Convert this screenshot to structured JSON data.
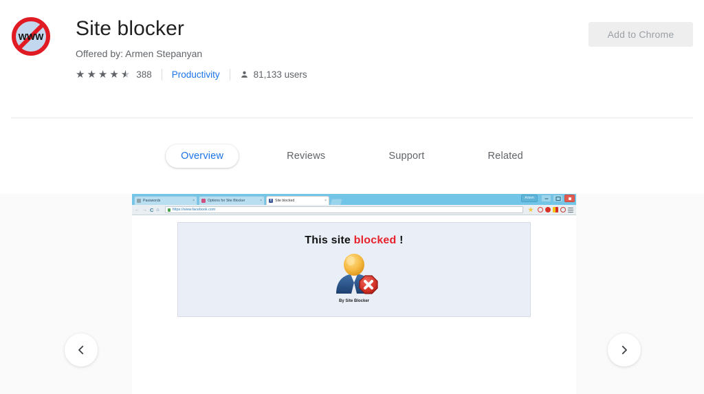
{
  "header": {
    "title": "Site blocker",
    "offered_by": "Offered by: Armen Stepanyan",
    "icon_name": "no-www-icon",
    "icon_text": "WWW",
    "rating": {
      "value": 4.5,
      "full_stars": 4,
      "half_star": true,
      "count": "388"
    },
    "category": "Productivity",
    "users": "81,133 users",
    "add_button": "Add to Chrome"
  },
  "tabs": [
    {
      "label": "Overview",
      "active": true
    },
    {
      "label": "Reviews",
      "active": false
    },
    {
      "label": "Support",
      "active": false
    },
    {
      "label": "Related",
      "active": false
    }
  ],
  "carousel": {
    "prev_label": "‹",
    "next_label": "›",
    "screenshot": {
      "browser": {
        "tabs": [
          {
            "label": "Passwords",
            "close": "×"
          },
          {
            "label": "Options for Site Blocker",
            "close": "×"
          },
          {
            "label": "Site blocked",
            "close": "×"
          }
        ],
        "window_user": "Artem",
        "url": "https://www.facebook.com",
        "nav_back": "←",
        "nav_forward": "→",
        "nav_reload": "C",
        "nav_home": "⌂"
      },
      "page": {
        "title_prefix": "This site ",
        "title_highlight": "blocked",
        "title_suffix": " !",
        "credit": "By Site Blocker"
      }
    }
  }
}
